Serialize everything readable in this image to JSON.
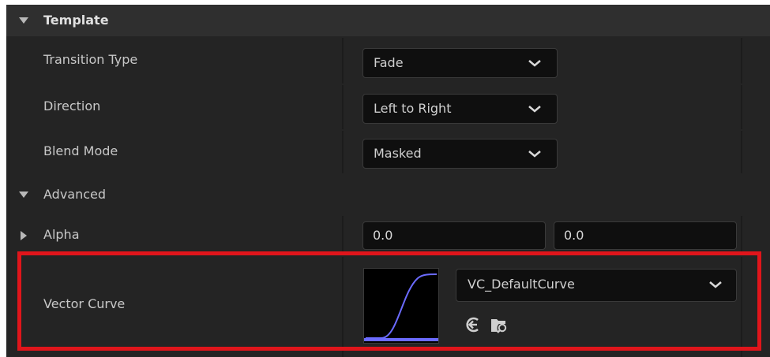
{
  "section": {
    "title": "Template"
  },
  "properties": [
    {
      "label": "Transition Type",
      "value": "Fade"
    },
    {
      "label": "Direction",
      "value": "Left to Right"
    },
    {
      "label": "Blend Mode",
      "value": "Masked"
    }
  ],
  "advanced": {
    "title": "Advanced",
    "alpha": {
      "label": "Alpha",
      "value_a": "0.0",
      "value_b": "0.0"
    },
    "vector_curve": {
      "label": "Vector Curve",
      "asset": "VC_DefaultCurve",
      "curve_color": "#6b6bff"
    }
  },
  "colors": {
    "highlight": "#e0151b",
    "background": "#242424"
  }
}
